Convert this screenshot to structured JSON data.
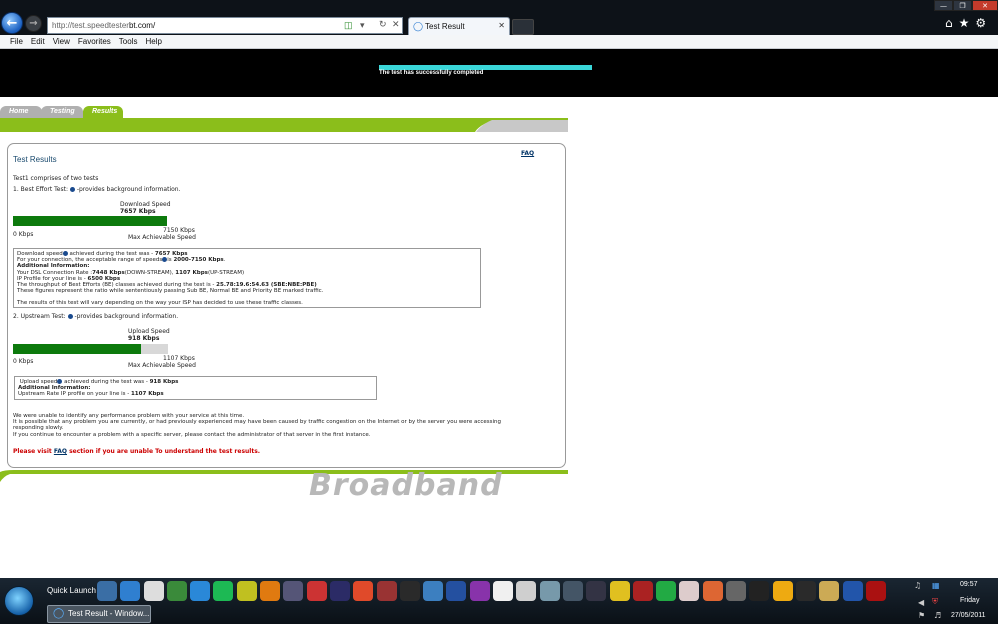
{
  "browser": {
    "address": "http://test.speedtester.bt.com/",
    "address_prefix": "http://test.speedtester",
    "address_domain": "bt.com/",
    "tab_title": "Test Result",
    "menu": [
      "File",
      "Edit",
      "View",
      "Favorites",
      "Tools",
      "Help"
    ]
  },
  "banner": {
    "message": "The test has successfully completed",
    "progress": 1.0
  },
  "site_tabs": [
    "Home",
    "Testing",
    "Results"
  ],
  "results": {
    "faq_link": "FAQ",
    "title": "Test Results",
    "intro": "Test1 comprises of two tests",
    "test1_heading_a": "1. Best Effort Test:",
    "test1_heading_b": "-provides background information.",
    "download": {
      "label": "Download Speed",
      "value_text": "7657 Kbps",
      "min_label": "0 Kbps",
      "max_value_text": "7150 Kbps",
      "max_label": "Max Achievable Speed",
      "fill": 1.0
    },
    "download_box": {
      "line1_a": "Download speed",
      "line1_b": "achieved during the test was -",
      "line1_val": "7657 Kbps",
      "line2_a": "For your connection, the acceptable range of speeds",
      "line2_b": "is",
      "line2_val": "2000-7150 Kbps",
      "additional": "Additional Information:",
      "line3_a": "Your DSL Connection Rate :",
      "line3_v1": "7448 Kbps",
      "line3_b": "(DOWN-STREAM),",
      "line3_v2": "1107 Kbps",
      "line3_c": "(UP-STREAM)",
      "line4_a": "IP Profile for your line is -",
      "line4_val": "6500 Kbps",
      "line5_a": "The throughput of Best Efforts (BE) classes achieved during the test is -",
      "line5_val": "25.78:19.6:54.63 (SBE:NBE:PBE)",
      "line6": "These figures represent the ratio while sententiously passing Sub BE, Normal BE and Priority BE marked traffic.",
      "line7": "The results of this test will vary depending on the way your ISP has decided to use these traffic classes."
    },
    "test2_heading_a": "2. Upstream Test:",
    "test2_heading_b": "-provides background information.",
    "upload": {
      "label": "Upload Speed",
      "value_text": "918 Kbps",
      "min_label": "0 Kbps",
      "max_value_text": "1107 Kbps",
      "max_label": "Max Achievable Speed",
      "fill": 0.829
    },
    "upload_box": {
      "line1_a": "Upload speed",
      "line1_b": "achieved during the test was -",
      "line1_val": "918 Kbps",
      "additional": "Additional Information:",
      "line2_a": "Upstream Rate IP profile on your line is -",
      "line2_val": "1107 Kbps"
    },
    "notes": [
      "We were unable to identify any performance problem with your service at this time.",
      "It is possible that any problem you are currently, or had previously experienced may have been caused by traffic congestion on the Internet or by the server you were accessing",
      "responding slowly.",
      "If you continue to encounter a problem with a specific server, please contact the administrator of that server in the first instance."
    ],
    "warning_a": "Please visit",
    "warning_link": "FAQ",
    "warning_b": "section if you are unable To understand the test results."
  },
  "logo_text": "Broadband",
  "taskbar": {
    "quick_launch": "Quick Launch",
    "task_label": "Test Result - Window...",
    "time": "09:57",
    "day": "Friday",
    "date": "27/05/2011",
    "ql_colors": [
      "#3a6ea5",
      "#2f7fd0",
      "#dddddd",
      "#3a8a3a",
      "#2a88d8",
      "#1db954",
      "#c0c020",
      "#e07a10",
      "#555577",
      "#cc3333",
      "#2b2b66",
      "#e04a2a",
      "#993333",
      "#2a2a2a",
      "#3c7fc0",
      "#2450a0",
      "#8833aa",
      "#f0f0f0",
      "#cfcfcf",
      "#7799aa",
      "#445566",
      "#333344",
      "#e0c020",
      "#aa2222",
      "#22aa44",
      "#ddcccc",
      "#dd6633",
      "#666666",
      "#222222",
      "#eeaa11",
      "#2a2a2a",
      "#ccaa55",
      "#2255aa",
      "#aa1111"
    ]
  }
}
